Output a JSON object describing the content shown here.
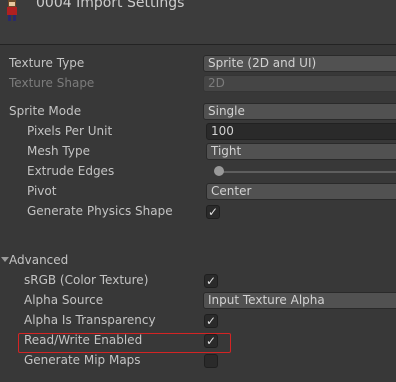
{
  "header": {
    "title": "0004 Import Settings",
    "icon": "sprite-asset-icon"
  },
  "fields": {
    "texture_type": {
      "label": "Texture Type",
      "value": "Sprite (2D and UI)"
    },
    "texture_shape": {
      "label": "Texture Shape",
      "value": "2D"
    },
    "sprite_mode": {
      "label": "Sprite Mode",
      "value": "Single"
    },
    "pixels_per_unit": {
      "label": "Pixels Per Unit",
      "value": "100"
    },
    "mesh_type": {
      "label": "Mesh Type",
      "value": "Tight"
    },
    "extrude_edges": {
      "label": "Extrude Edges",
      "value": 1
    },
    "pivot": {
      "label": "Pivot",
      "value": "Center"
    },
    "generate_physics_shape": {
      "label": "Generate Physics Shape",
      "checked": true
    }
  },
  "advanced": {
    "label": "Advanced",
    "srgb": {
      "label": "sRGB (Color Texture)",
      "checked": true
    },
    "alpha_source": {
      "label": "Alpha Source",
      "value": "Input Texture Alpha"
    },
    "alpha_is_transparency": {
      "label": "Alpha Is Transparency",
      "checked": true
    },
    "read_write_enabled": {
      "label": "Read/Write Enabled",
      "checked": true
    },
    "generate_mip_maps": {
      "label": "Generate Mip Maps",
      "checked": false
    }
  },
  "checkmark": "✓",
  "colors": {
    "highlight": "#d42424",
    "background": "#383838"
  }
}
